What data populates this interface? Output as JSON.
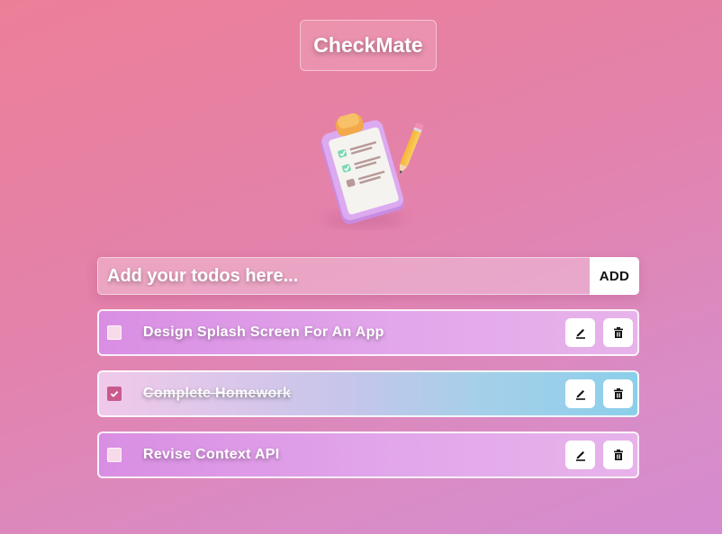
{
  "header": {
    "title": "CheckMate"
  },
  "hero": {
    "icon": "clipboard-checklist-pencil-icon"
  },
  "form": {
    "input_placeholder": "Add your todos here...",
    "input_value": "",
    "add_label": "ADD"
  },
  "todos": [
    {
      "text": "Design Splash Screen For An App",
      "completed": false
    },
    {
      "text": "Complete Homework",
      "completed": true
    },
    {
      "text": "Revise Context API",
      "completed": false
    }
  ],
  "icons": {
    "edit": "pencil-icon",
    "delete": "trash-icon"
  },
  "colors": {
    "completed_checkbox": "#c85a8c",
    "completed_row_accent": "#8ccfea"
  }
}
